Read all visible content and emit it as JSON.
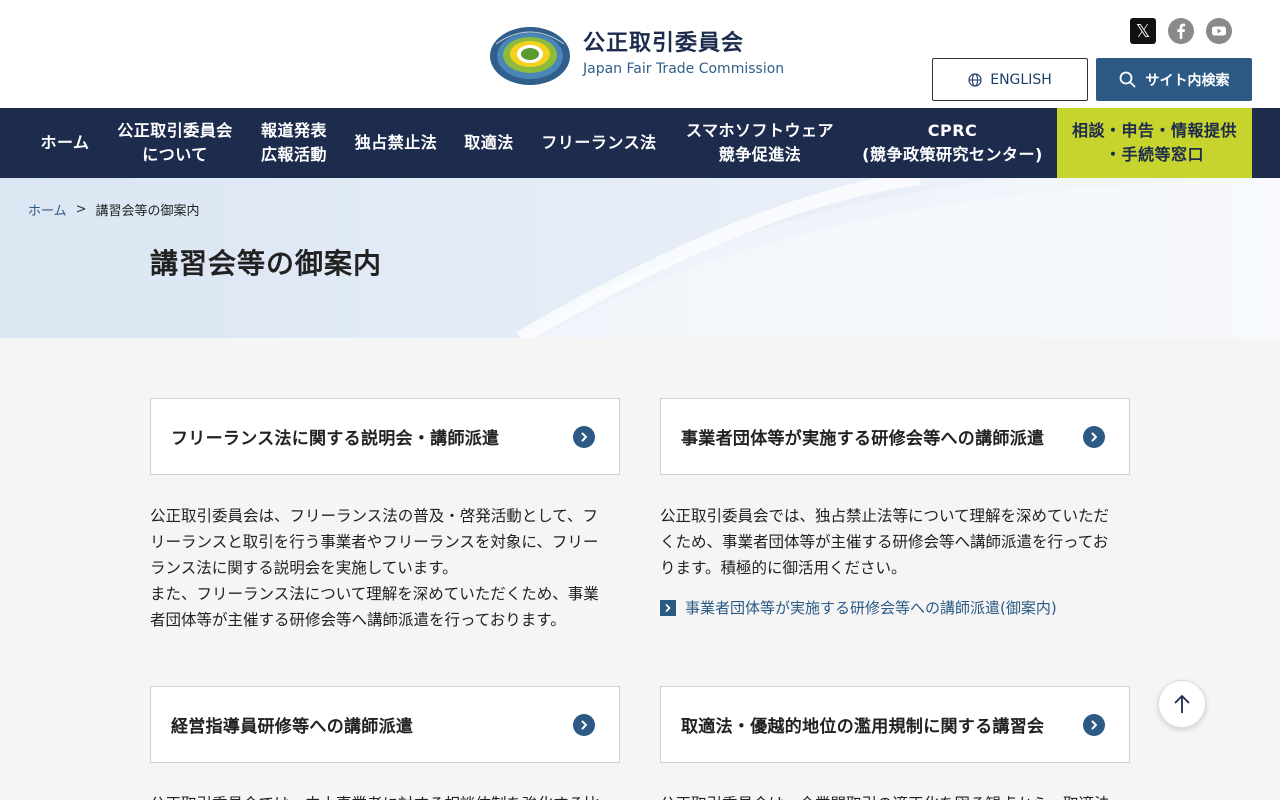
{
  "header": {
    "logo_ja": "公正取引委員会",
    "logo_en": "Japan Fair Trade Commission",
    "english_label": "ENGLISH",
    "search_label": "サイト内検索",
    "x_glyph": "𝕏"
  },
  "nav": [
    {
      "label": "ホーム"
    },
    {
      "label": "公正取引委員会\nについて"
    },
    {
      "label": "報道発表\n広報活動"
    },
    {
      "label": "独占禁止法"
    },
    {
      "label": "取適法"
    },
    {
      "label": "フリーランス法"
    },
    {
      "label": "スマホソフトウェア\n競争促進法"
    },
    {
      "label": "CPRC\n(競争政策研究センター)"
    },
    {
      "label": "相談・申告・情報提供\n・手続等窓口"
    }
  ],
  "breadcrumb": {
    "home": "ホーム",
    "separator": ">",
    "current": "講習会等の御案内"
  },
  "page_title": "講習会等の御案内",
  "cards": [
    {
      "title": "フリーランス法に関する説明会・講師派遣",
      "desc": "公正取引委員会は、フリーランス法の普及・啓発活動として、フ\nリーランスと取引を行う事業者やフリーランスを対象に、フリー\nランス法に関する説明会を実施しています。\nまた、フリーランス法について理解を深めていただくため、事業\n者団体等が主催する研修会等へ講師派遣を行っております。"
    },
    {
      "title": "事業者団体等が実施する研修会等への講師派遣",
      "desc": "公正取引委員会では、独占禁止法等について理解を深めていただ\nくため、事業者団体等が主催する研修会等へ講師派遣を行ってお\nります。積極的に御活用ください。",
      "link": "事業者団体等が実施する研修会等への講師派遣(御案内)"
    },
    {
      "title": "経営指導員研修等への講師派遣",
      "desc": "公正取引委員会では、中小事業者に対する相談体制を強化する比"
    },
    {
      "title": "取適法・優越的地位の濫用規制に関する講習会",
      "desc": "公正取引委員会は、企業間取引の適正化を図る観点から、取適法"
    }
  ],
  "colors": {
    "navy": "#1d2b4d",
    "accent_blue": "#2c5a85",
    "lime": "#c8d42e"
  }
}
